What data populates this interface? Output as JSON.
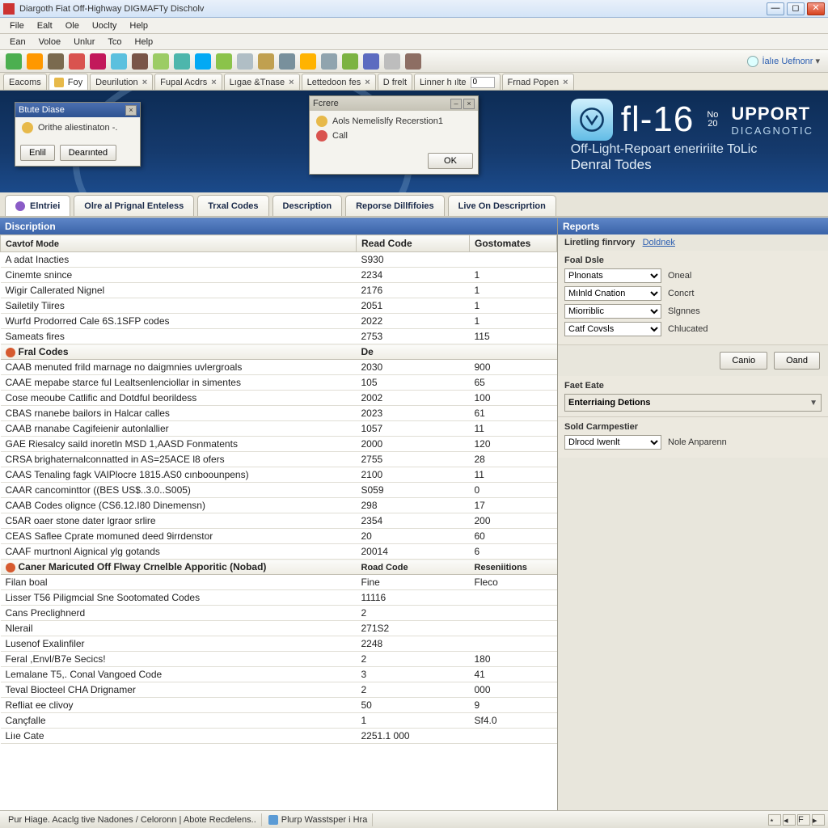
{
  "window": {
    "title": "Diargoth Fiat Off-Highway DIGMAFTy Discholv"
  },
  "menu1": [
    "File",
    "Ealt",
    "Ole",
    "Uoclty",
    "Help"
  ],
  "menu2": [
    "Ean",
    "Voloe",
    "Unlur",
    "Tco",
    "Help"
  ],
  "user": "İalıe Uefnonr",
  "doctabs": [
    {
      "label": "Eacoms"
    },
    {
      "label": "Foy",
      "icon": true,
      "active": true
    },
    {
      "label": "Deurilution",
      "close": true
    },
    {
      "label": "Fupal Acdrs",
      "close": true
    },
    {
      "label": "Lıgae &Tnase",
      "close": true
    },
    {
      "label": "Lettedoon fes",
      "close": true
    },
    {
      "label": "D frelt"
    },
    {
      "label": "Linner h ılte",
      "input": "0"
    },
    {
      "label": "Frnad Popen",
      "close": true
    }
  ],
  "popups": {
    "left": {
      "title": "Btute Diase",
      "line": "Orithe aliestinaton -.",
      "btn1": "Enlil",
      "btn2": "Dearınted"
    },
    "center": {
      "title": "Fcrere",
      "line1": "Aols Nemelislfy Recerstion1",
      "line2": "Call",
      "ok": "OK"
    }
  },
  "brand": {
    "fl": "fl-16",
    "stack_top": "No",
    "stack_bot": "20",
    "upport": "UPPORT",
    "diag": "DICAGNOTIC",
    "sub1": "Off-Light-Repoart eneririite ToLic",
    "sub2": "Denral Todes"
  },
  "bigtabs": [
    "Elntriei",
    "Olre al Prignal Enteless",
    "Trxal Codes",
    "Description",
    "Reporse Dillfifoies",
    "Live On Descriprtion"
  ],
  "left_panel_title": "Discription",
  "right_panel_title": "Reports",
  "columns": {
    "c1": "Cavtof Mode",
    "c2": "Read Code",
    "c3": "Gostomates"
  },
  "rows1": [
    [
      "A adat Inacties",
      "S930",
      ""
    ],
    [
      "Cinemte snince",
      "2234",
      "1"
    ],
    [
      "Wigir Callerated Nignel",
      "2176",
      "1"
    ],
    [
      "Sailetily Tiires",
      "2051",
      "1"
    ],
    [
      "Wurfd Prodorred Cale 6S.1SFP codes",
      "2022",
      "1"
    ],
    [
      "Sameats fires",
      "2753",
      "115"
    ]
  ],
  "group2": {
    "label": "Fral Codes",
    "c2": "De"
  },
  "rows2": [
    [
      "CAAB menuted frild marnage no daigmnies uvlergroals",
      "2030",
      "900"
    ],
    [
      "CAAE mepabe starce ful Lealtsenlenciollar in simentes",
      "105",
      "65"
    ],
    [
      "Cose meoube Catlific and Dotdful beorildess",
      "2002",
      "100"
    ],
    [
      "CBAS rnanebe bailors in Halcar calles",
      "2023",
      "61"
    ],
    [
      "CAAB rnanabe Cagifeienir autonlallier",
      "1057",
      "11"
    ],
    [
      "GAE Riesalcy saild inoretln МSD 1,AASD Fonmatents",
      "2000",
      "120"
    ],
    [
      "CRSA brighaternalconnatted in AS=25ACE l8 ofers",
      "2755",
      "28"
    ],
    [
      "CAAS Tenaling fagk VAIPlocre 1815.AS0 cınboounpens)",
      "2100",
      "11"
    ],
    [
      "CAAR cancominttor ((BES US$..3.0..S005)",
      "S059",
      "0"
    ],
    [
      "CAAB Codes olignce (CS6.12.I80 Dinemensn)",
      "298",
      "17"
    ],
    [
      "C5AR oaer stone dater lgraor srlire",
      "2354",
      "200"
    ],
    [
      "CEAS Saflee Cprate momuned deed 9irrdenstor",
      "20",
      "60"
    ],
    [
      "CAAF murtnonl Aignical ylg gotands",
      "20014",
      "6"
    ]
  ],
  "group3": {
    "label": "Caner Maricuted Off Flway Crnelble Apporitic (Nobad)",
    "c2": "Road Code",
    "c3": "Reseniitions"
  },
  "rows3": [
    [
      "Filan boal",
      "Fine",
      "Fleco"
    ],
    [
      "Lisser T56 Piligmcial Sne Sootomated Codes",
      "11116",
      ""
    ],
    [
      "Cans Preclighnerd",
      "2",
      ""
    ],
    [
      "Nlerail",
      "271S2",
      ""
    ],
    [
      "Lusenof Exalinfiler",
      "2248",
      ""
    ],
    [
      "Feral ,Envl/B7e Secics!",
      "2",
      "180"
    ],
    [
      "Lemalane T5,. Conal Vangoed Code",
      "3",
      "41"
    ],
    [
      "Teval Biocteel CHA Drignamer",
      "2",
      "000"
    ],
    [
      "Refliat ee clivoy",
      "50",
      "9"
    ],
    [
      "Cançfalle",
      "1",
      "Sf4.0"
    ],
    [
      "Liıe Cate",
      "2251.1 000",
      ""
    ]
  ],
  "reports": {
    "links_label": "Liretling finrvory",
    "links_link": "Doldnek",
    "foal_date": "Foal Dsle",
    "sel1": "Plnonats",
    "cap1": "Oneal",
    "sel2": "Mılnld Cnation",
    "cap2": "Concrt",
    "sel3": "Miorriblic",
    "cap3": "Slgnnes",
    "sel4": "Catf Covsls",
    "cap4": "Chlucated",
    "btn1": "Canio",
    "btn2": "Oand",
    "fast_eate": "Faet Eate",
    "dd_label": "Enterriaing Detions",
    "sold": "Sold Carmpestier",
    "sel5": "Dlrocd Iwenlt",
    "cap5": "Nole Anparenn"
  },
  "status": {
    "left": "Pur Hiage. Acaclg tive Nadones / Celoronn | Abote Recdelens..",
    "mid": "Plurp Wasstsper i Hra"
  },
  "toolbar_colors": [
    "#4caf50",
    "#ff9800",
    "#7a6a4f",
    "#d9534f",
    "#c2185b",
    "#5bc0de",
    "#795548",
    "#9ccc65",
    "#4db6ac",
    "#03a9f4",
    "#8bc34a",
    "#b0bec5",
    "#c0a050",
    "#78909c",
    "#ffb300",
    "#90a4ae",
    "#7cb342",
    "#5c6bc0",
    "#bdbdbd",
    "#8d6e63"
  ]
}
